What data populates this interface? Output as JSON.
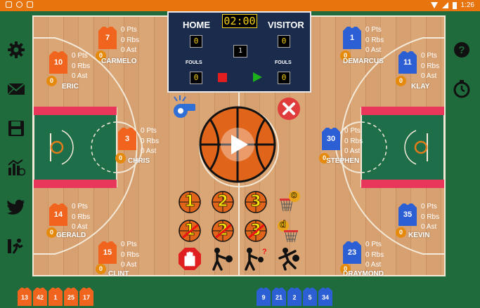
{
  "status_bar": {
    "time": "1:26"
  },
  "colors": {
    "home": "#f0641e",
    "visitor": "#2d5fd4",
    "foul_badge": "#e68a0b",
    "scoreboard_bg": "#1a2b4c",
    "lcd_text": "#f7d31b"
  },
  "sidebar": {
    "left_icons": [
      "gear-icon",
      "mail-icon",
      "save-icon",
      "stats-icon",
      "twitter-icon",
      "substitution-icon"
    ],
    "right_icons": [
      "help-icon",
      "stopwatch-icon"
    ]
  },
  "scoreboard": {
    "home_label": "HOME",
    "visitor_label": "VISITOR",
    "clock": "02:00",
    "home_score": "0",
    "visitor_score": "0",
    "period": "1",
    "home_fouls_label": "FOULS",
    "visitor_fouls_label": "FOULS",
    "home_fouls": "0",
    "visitor_fouls": "0"
  },
  "home_players": [
    {
      "number": "7",
      "name": "CARMELO",
      "pts": "0 Pts",
      "rbs": "0 Rbs",
      "ast": "0 Ast",
      "fouls": "0"
    },
    {
      "number": "10",
      "name": "ERIC",
      "pts": "0 Pts",
      "rbs": "0 Rbs",
      "ast": "0 Ast",
      "fouls": "0"
    },
    {
      "number": "3",
      "name": "CHRIS",
      "pts": "0 Pts",
      "rbs": "0 Rbs",
      "ast": "0 Ast",
      "fouls": "0"
    },
    {
      "number": "14",
      "name": "GERALD",
      "pts": "0 Pts",
      "rbs": "0 Rbs",
      "ast": "0 Ast",
      "fouls": "0"
    },
    {
      "number": "15",
      "name": "CLINT",
      "pts": "0 Pts",
      "rbs": "0 Rbs",
      "ast": "0 Ast",
      "fouls": "0"
    }
  ],
  "visitor_players": [
    {
      "number": "1",
      "name": "DEMARCUS",
      "pts": "0 Pts",
      "rbs": "0 Rbs",
      "ast": "0 Ast",
      "fouls": "0"
    },
    {
      "number": "11",
      "name": "KLAY",
      "pts": "0 Pts",
      "rbs": "0 Rbs",
      "ast": "0 Ast",
      "fouls": "0"
    },
    {
      "number": "30",
      "name": "STEPHEN",
      "pts": "0 Pts",
      "rbs": "0 Rbs",
      "ast": "0 Ast",
      "fouls": "0"
    },
    {
      "number": "35",
      "name": "KEVIN",
      "pts": "0 Pts",
      "rbs": "0 Rbs",
      "ast": "0 Ast",
      "fouls": "0"
    },
    {
      "number": "23",
      "name": "DRAYMOND",
      "pts": "0 Pts",
      "rbs": "0 Rbs",
      "ast": "0 Ast",
      "fouls": "0"
    }
  ],
  "actions": {
    "one": "1",
    "two": "2",
    "three": "3",
    "rebound_offense_label": "o",
    "rebound_defense_label": "d"
  },
  "home_bench": [
    "13",
    "42",
    "1",
    "25",
    "17"
  ],
  "visitor_bench": [
    "9",
    "21",
    "2",
    "5",
    "34"
  ]
}
